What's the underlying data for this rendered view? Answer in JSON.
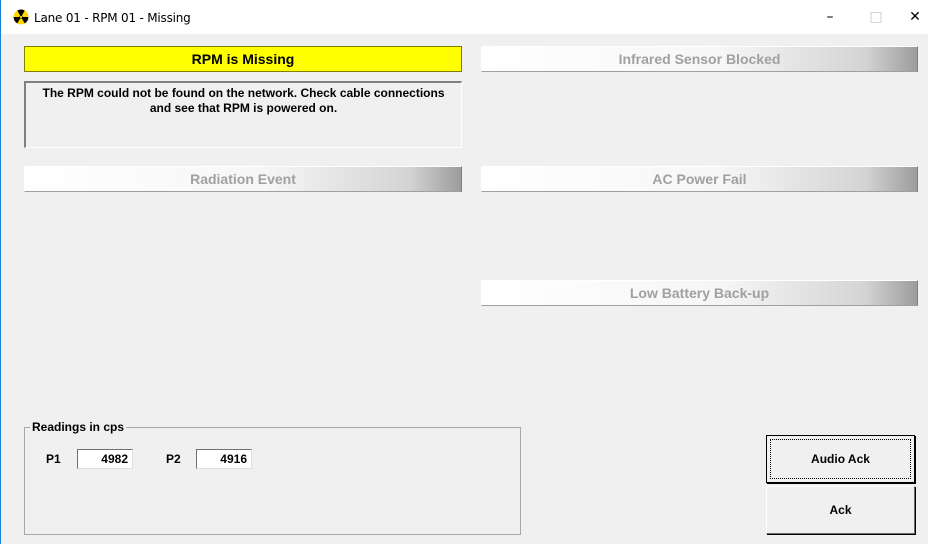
{
  "window": {
    "title": "Lane 01 - RPM 01 - Missing",
    "icon": "radiation-icon",
    "controls": {
      "minimize": "–",
      "maximize": "□",
      "close": "✕"
    }
  },
  "alarms": {
    "rpm_missing": "RPM is Missing",
    "infrared_sensor_blocked": "Infrared Sensor Blocked",
    "radiation_event": "Radiation Event",
    "ac_power_fail": "AC Power Fail",
    "low_battery": "Low Battery Back-up"
  },
  "message": {
    "line1": "The RPM could not be found on the network.  Check cable connections",
    "line2": "and see that RPM is powered on."
  },
  "readings": {
    "group_title": "Readings in cps",
    "p1_label": "P1",
    "p1_value": "4982",
    "p2_label": "P2",
    "p2_value": "4916"
  },
  "buttons": {
    "audio_ack": "Audio Ack",
    "ack": "Ack"
  },
  "colors": {
    "active_alarm": "#ffff00",
    "inactive_alarm_text": "#a0a0a0",
    "window_bg": "#f0f0f0"
  }
}
